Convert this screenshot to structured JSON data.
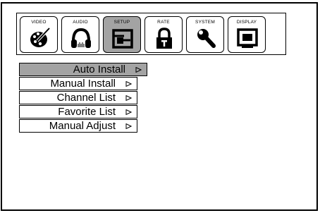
{
  "tabs": [
    {
      "label": "VIDEO",
      "icon": "video-palette-icon",
      "selected": false
    },
    {
      "label": "AUDIO",
      "icon": "headphones-icon",
      "selected": false
    },
    {
      "label": "SETUP",
      "icon": "setup-input-icon",
      "selected": true
    },
    {
      "label": "RATE",
      "icon": "padlock-icon",
      "selected": false
    },
    {
      "label": "SYSTEM",
      "icon": "wrench-icon",
      "selected": false
    },
    {
      "label": "DISPLAY",
      "icon": "monitor-icon",
      "selected": false
    }
  ],
  "menu": {
    "items": [
      {
        "label": "Auto Install",
        "selected": true
      },
      {
        "label": "Manual Install",
        "selected": false
      },
      {
        "label": "Channel List",
        "selected": false
      },
      {
        "label": "Favorite List",
        "selected": false
      },
      {
        "label": "Manual Adjust",
        "selected": false
      }
    ]
  },
  "colors": {
    "selected_background": "#a3a3a3",
    "border": "#000000",
    "background": "#ffffff"
  }
}
